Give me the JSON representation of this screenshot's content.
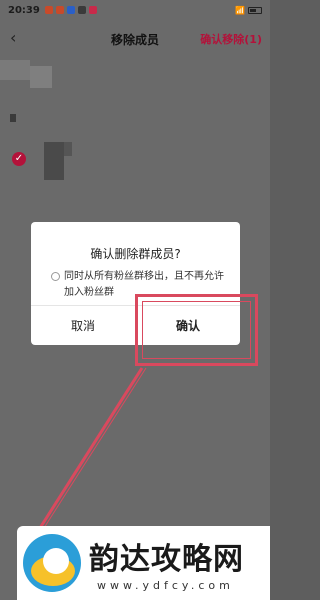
{
  "status_bar": {
    "time": "20:39",
    "right_text": "▮"
  },
  "header": {
    "back_icon": "chevron-left-icon",
    "title": "移除成员",
    "confirm_label": "确认移除(1)"
  },
  "dialog": {
    "title": "确认删除群成员?",
    "option_text": "同时从所有粉丝群移出，且不再允许加入粉丝群",
    "cancel_label": "取消",
    "confirm_label": "确认"
  },
  "watermark": {
    "title": "韵达攻略网",
    "url": "www.ydfcy.com"
  },
  "colors": {
    "accent": "#b3123a",
    "highlight": "#d9495e",
    "overlay": "#6a6a6a"
  }
}
